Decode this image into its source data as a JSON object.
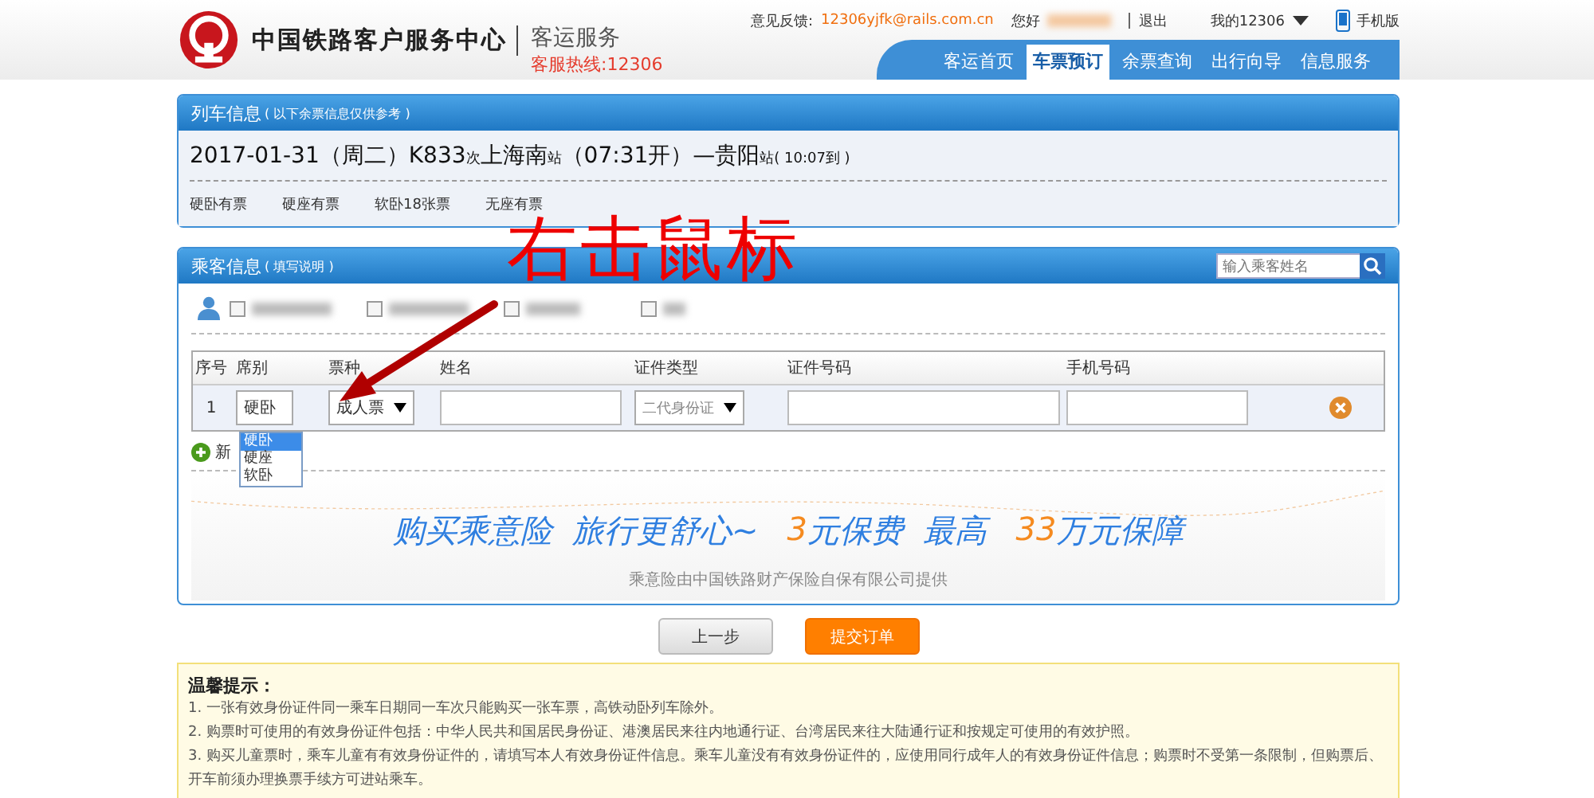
{
  "header": {
    "title": "中国铁路客户服务中心",
    "subtitle": "客运服务",
    "hotline": "客服热线:12306",
    "feedback_label": "意见反馈:",
    "feedback_email": "12306yjfk@rails.com.cn",
    "greeting": "您好",
    "logout": "退出",
    "account": "我的12306",
    "mobile": "手机版",
    "nav": [
      {
        "label": "客运首页",
        "selected": false
      },
      {
        "label": "车票预订",
        "selected": true
      },
      {
        "label": "余票查询",
        "selected": false
      },
      {
        "label": "出行向导",
        "selected": false
      },
      {
        "label": "信息服务",
        "selected": false
      }
    ]
  },
  "train_panel": {
    "title": "列车信息",
    "note": "( 以下余票信息仅供参考 )",
    "route": [
      {
        "text": "2017-01-31（周二）",
        "kind": "big"
      },
      {
        "text": "K833",
        "kind": "big"
      },
      {
        "text": "次",
        "kind": "small"
      },
      {
        "text": "上海南",
        "kind": "big"
      },
      {
        "text": "站",
        "kind": "small"
      },
      {
        "text": "（07:31开）—贵阳",
        "kind": "big"
      },
      {
        "text": "站",
        "kind": "small"
      },
      {
        "text": "( 10:07到 )",
        "kind": "small"
      }
    ],
    "seats": [
      "硬卧有票",
      "硬座有票",
      "软卧18张票",
      "无座有票"
    ]
  },
  "passenger_panel": {
    "title": "乘客信息",
    "note": "( 填写说明 )",
    "search": {
      "placeholder": "输入乘客姓名"
    },
    "passengers": [
      {
        "checked": false
      },
      {
        "checked": false
      },
      {
        "checked": false
      },
      {
        "checked": false
      }
    ],
    "columns": [
      "序号",
      "席别",
      "票种",
      "姓名",
      "证件类型",
      "证件号码",
      "手机号码"
    ],
    "rows": [
      {
        "index": "1",
        "seat": "硬卧",
        "ticket_type": "成人票",
        "id_type": "二代身份证"
      }
    ],
    "seat_options": [
      {
        "label": "硬卧",
        "selected": true
      },
      {
        "label": "硬座",
        "selected": false
      },
      {
        "label": "软卧",
        "selected": false
      }
    ],
    "add_label": "新"
  },
  "insurance": {
    "slogan": [
      {
        "text": "购买乘意险  旅行更舒心~",
        "kind": "plain"
      },
      {
        "text": "3",
        "kind": "accent"
      },
      {
        "text": "元保费  最高",
        "kind": "plain"
      },
      {
        "text": "33",
        "kind": "accent"
      },
      {
        "text": "万元保障",
        "kind": "plain"
      }
    ],
    "provider": "乘意险由中国铁路财产保险自保有限公司提供"
  },
  "buttons": {
    "back": "上一步",
    "submit": "提交订单"
  },
  "tips": {
    "title": "温馨提示：",
    "items": [
      "1. 一张有效身份证件同一乘车日期同一车次只能购买一张车票，高铁动卧列车除外。",
      "2. 购票时可使用的有效身份证件包括：中华人民共和国居民身份证、港澳居民来往内地通行证、台湾居民来往大陆通行证和按规定可使用的有效护照。",
      "3. 购买儿童票时，乘车儿童有有效身份证件的，请填写本人有效身份证件信息。乘车儿童没有有效身份证件的，应使用同行成年人的有效身份证件信息；购票时不受第一条限制，但购票后、开车前须办理换票手续方可进站乘车。"
    ]
  },
  "annotation": {
    "text": "右击鼠标"
  }
}
